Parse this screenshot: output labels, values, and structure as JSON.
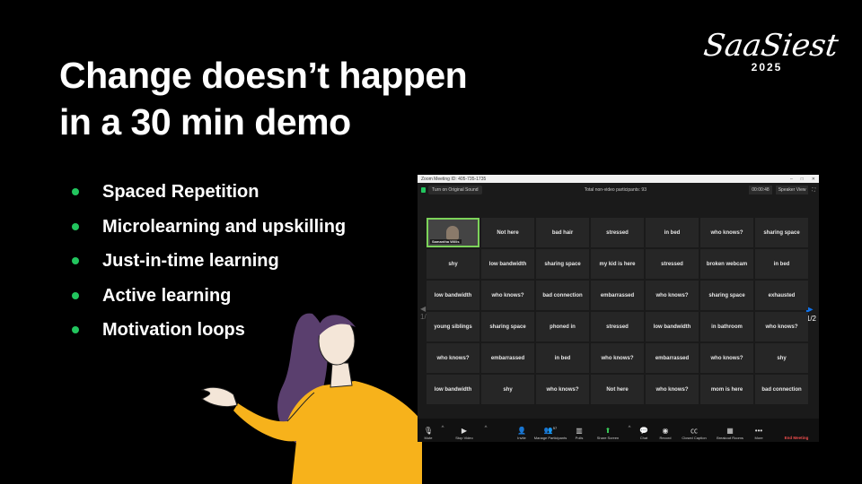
{
  "slide": {
    "title_line1": "Change doesn’t happen",
    "title_line2": "in a 30 min demo"
  },
  "logo": {
    "script": "SaaSiest",
    "year": "2025"
  },
  "bullets": [
    "Spaced Repetition",
    "Microlearning and upskilling",
    "Just-in-time learning",
    "Active learning",
    "Motivation loops"
  ],
  "colors": {
    "background": "#000000",
    "bullet_dot": "#22c55e",
    "shirt": "#f7b21b",
    "hair": "#5a3f6e",
    "zoom_active_border": "#7cd35a",
    "end_meeting": "#f14d4d"
  },
  "zoom": {
    "window_title": "Zoom Meeting ID: 405-735-1735",
    "original_sound": "Turn on Original Sound",
    "participants_label": "Total non-video participants: 93",
    "timer": "00:00:48",
    "view": "Speaker View",
    "page_left": "1/2",
    "page_right": "1/2",
    "tiles": [
      "",
      "Not here",
      "bad hair",
      "stressed",
      "in bed",
      "who knows?",
      "sharing space",
      "shy",
      "low bandwidth",
      "sharing space",
      "my kid is here",
      "stressed",
      "broken webcam",
      "in bed",
      "low bandwidth",
      "who knows?",
      "bad connection",
      "embarrassed",
      "who knows?",
      "sharing space",
      "exhausted",
      "young siblings",
      "sharing space",
      "phoned in",
      "stressed",
      "low bandwidth",
      "in bathroom",
      "who knows?",
      "who knows?",
      "embarrassed",
      "in bed",
      "who knows?",
      "embarrassed",
      "who knows?",
      "shy",
      "low bandwidth",
      "shy",
      "who knows?",
      "Not here",
      "who knows?",
      "mom is here",
      "bad connection"
    ],
    "video_tile_name": "Samantha Willis",
    "toolbar": {
      "mute": "Mute",
      "stop_video": "Stop Video",
      "invite": "Invite",
      "manage_participants": "Manage Participants",
      "participants_count": "57",
      "polls": "Polls",
      "share_screen": "Share Screen",
      "chat": "Chat",
      "record": "Record",
      "closed_caption": "Closed Caption",
      "breakout_rooms": "Breakout Rooms",
      "more": "More",
      "end_meeting": "End Meeting"
    }
  }
}
